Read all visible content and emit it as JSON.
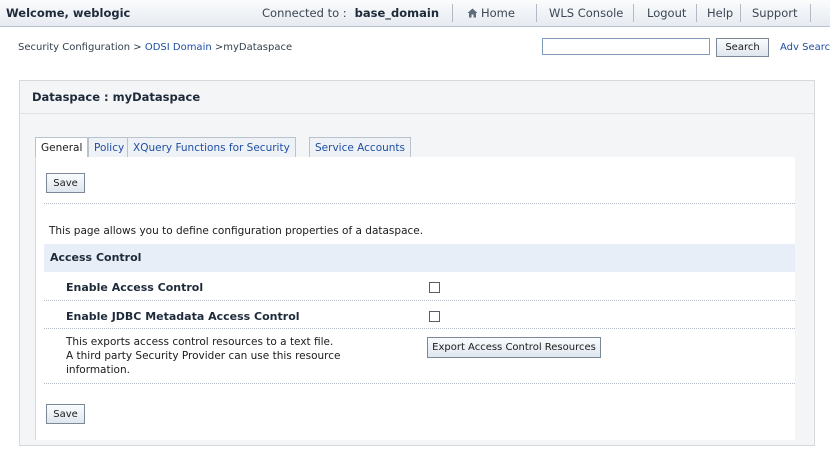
{
  "header": {
    "welcome": "Welcome, weblogic",
    "connected_label": "Connected to :",
    "domain": "base_domain",
    "links": {
      "home": "Home",
      "wls_console": "WLS Console",
      "logout": "Logout",
      "help": "Help",
      "support": "Support"
    },
    "home_icon": "home-icon"
  },
  "breadcrumb": {
    "root": "Security Configuration",
    "sep1": ">",
    "domain_link": "ODSI Domain",
    "sep2": ">",
    "current": "myDataspace"
  },
  "search": {
    "value": "",
    "button": "Search",
    "adv": "Adv Search"
  },
  "panel": {
    "title": "Dataspace : myDataspace"
  },
  "tabs": [
    {
      "label": "General",
      "active": true
    },
    {
      "label": "Policy",
      "active": false
    },
    {
      "label": "XQuery Functions for Security",
      "active": false
    },
    {
      "label": "Service Accounts",
      "active": false
    }
  ],
  "form": {
    "save_top": "Save",
    "description": "This page allows you to define configuration properties of a dataspace.",
    "section_title": "Access Control",
    "enable_access_control": "Enable Access Control",
    "enable_access_control_checked": false,
    "enable_jdbc": "Enable JDBC Metadata Access Control",
    "enable_jdbc_checked": false,
    "export_text": [
      "This exports access control resources to a text file.",
      "A third party Security Provider can use this resource",
      "information."
    ],
    "export_button": "Export Access Control Resources",
    "save_bottom": "Save"
  },
  "colors": {
    "link": "#1e4fa3",
    "section_bg": "#e8eef7",
    "panel_bg": "#f4f5f6"
  }
}
